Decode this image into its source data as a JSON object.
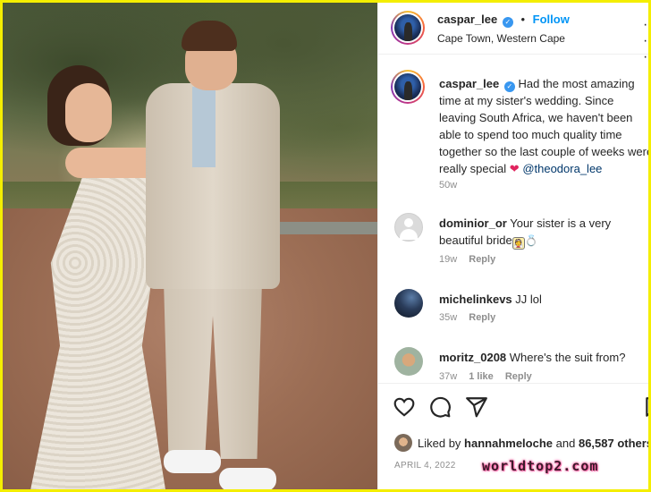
{
  "post": {
    "username": "caspar_lee",
    "verified_icon": "verified-badge-icon",
    "separator": "•",
    "follow_label": "Follow",
    "location": "Cape Town, Western Cape",
    "more_icon": "more-options-icon",
    "more_glyph": "· · ·"
  },
  "caption": {
    "username": "caspar_lee",
    "text": "Had the most amazing time at my sister's wedding. Since leaving South Africa, we haven't been able to spend too much quality time together so the last couple of weeks were really special",
    "emoji": "❤",
    "mention": "@theodora_lee",
    "time": "50w"
  },
  "comments": [
    {
      "username": "dominior_or",
      "text": "Your sister is a very beautiful bride",
      "emojis": [
        "👰",
        "💍"
      ],
      "time": "19w",
      "likes": "",
      "reply": "Reply",
      "avatar": "default-avatar-icon"
    },
    {
      "username": "michelinkevs",
      "text": "JJ lol",
      "emojis": [],
      "time": "35w",
      "likes": "",
      "reply": "Reply",
      "avatar": "user-avatar"
    },
    {
      "username": "moritz_0208",
      "text": "Where's the suit from?",
      "emojis": [],
      "time": "37w",
      "likes": "1 like",
      "reply": "Reply",
      "avatar": "user-avatar"
    }
  ],
  "actions": {
    "like_icon": "heart-icon",
    "comment_icon": "comment-icon",
    "share_icon": "send-icon",
    "save_icon": "bookmark-icon"
  },
  "likes": {
    "prefix": "Liked by",
    "user": "hannahmeloche",
    "and": "and",
    "count_text": "86,587 others"
  },
  "date": "APRIL 4, 2022",
  "watermark": "worldtop2.com",
  "colors": {
    "frame_border": "#f4ee00",
    "follow_blue": "#0095f6",
    "mention_blue": "#00376b",
    "heart_red": "#e0245e"
  }
}
